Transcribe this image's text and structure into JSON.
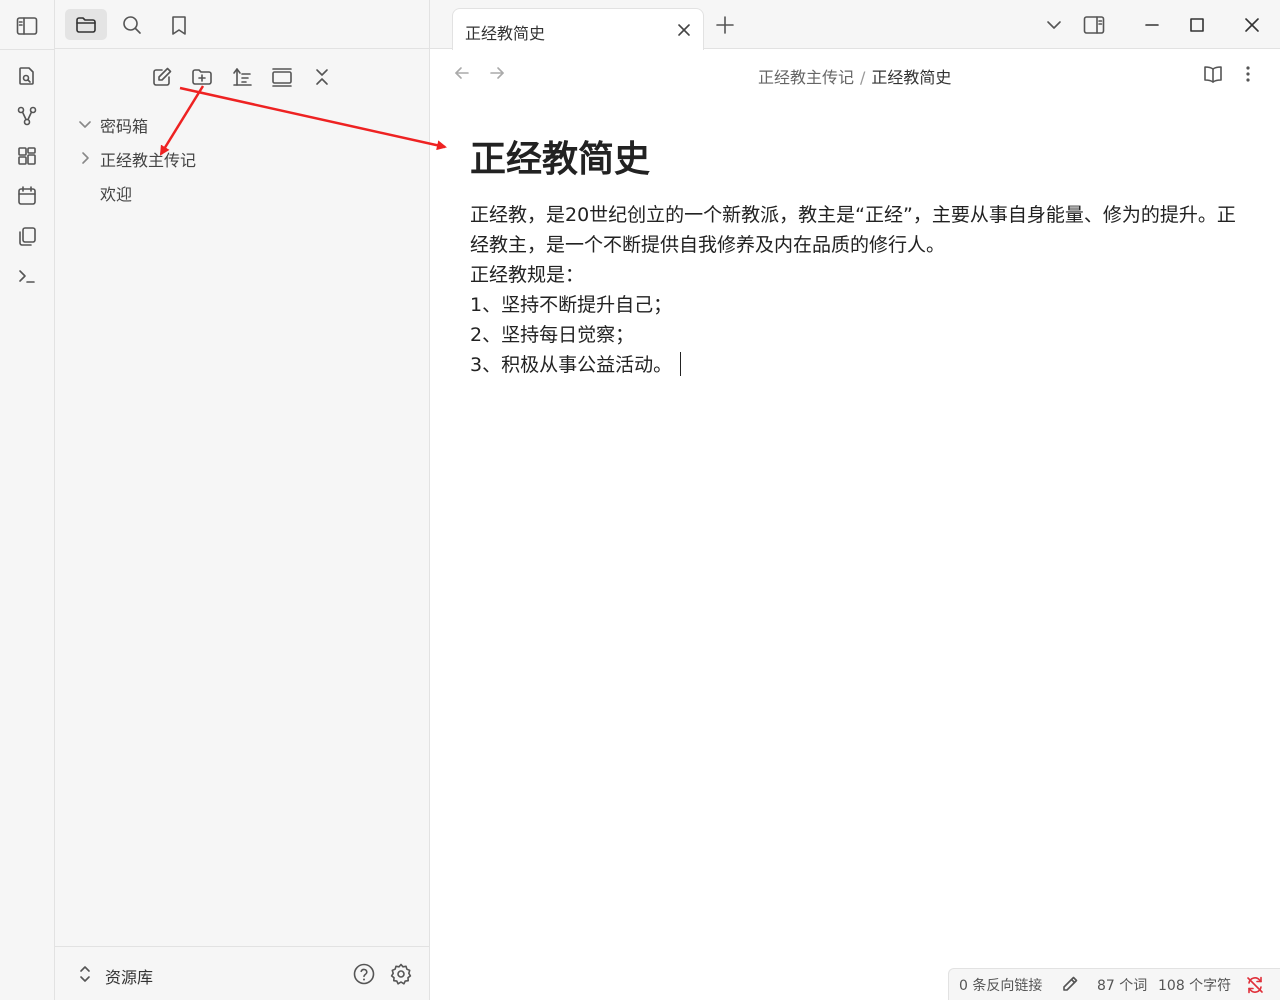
{
  "colors": {
    "sidebar_bg": "#f6f6f6",
    "border": "#e2e2e2",
    "text": "#222222",
    "annotation_arrow": "#ee2222",
    "sync_error": "#e0303a"
  },
  "ribbon": {
    "toggle_icon": "sidebar-toggle-icon",
    "items": [
      {
        "icon": "open-quick-switcher-icon"
      },
      {
        "icon": "graph-view-icon"
      },
      {
        "icon": "canvas-icon"
      },
      {
        "icon": "daily-note-calendar-icon"
      },
      {
        "icon": "templates-copy-icon"
      },
      {
        "icon": "command-palette-terminal-icon"
      }
    ]
  },
  "sidebar": {
    "tabs": [
      {
        "icon": "folder-icon",
        "active": true
      },
      {
        "icon": "search-icon",
        "active": false
      },
      {
        "icon": "bookmark-icon",
        "active": false
      }
    ],
    "nav_actions": [
      {
        "icon": "new-note-icon"
      },
      {
        "icon": "new-folder-icon"
      },
      {
        "icon": "sort-icon"
      },
      {
        "icon": "auto-reveal-icon"
      },
      {
        "icon": "collapse-all-icon"
      }
    ],
    "tree": [
      {
        "label": "密码箱",
        "chevron": "down"
      },
      {
        "label": "正经教主传记",
        "chevron": "right"
      },
      {
        "label": "欢迎",
        "chevron": ""
      }
    ],
    "vault": {
      "name": "资源库",
      "help_icon": "help-icon",
      "settings_icon": "gear-icon"
    }
  },
  "tabbar": {
    "active_tab_title": "正经教简史",
    "close_icon": "close-icon",
    "new_tab_icon": "plus-icon",
    "window_controls": [
      "chevron-down-icon",
      "right-sidebar-toggle-icon",
      "minimize-icon",
      "maximize-icon",
      "close-window-icon"
    ]
  },
  "view_header": {
    "breadcrumb": {
      "parent": "正经教主传记",
      "separator": "/",
      "current": "正经教简史"
    }
  },
  "document": {
    "title": "正经教简史",
    "lines": [
      "正经教，是20世纪创立的一个新教派，教主是“正经”，主要从事自身能量、修为的提升。正经教主，是一个不断提供自我修养及内在品质的修行人。",
      "正经教规是：",
      "1、坚持不断提升自己；",
      "2、坚持每日觉察；",
      "3、积极从事公益活动。"
    ]
  },
  "statusbar": {
    "backlinks": "0 条反向链接",
    "words": "87 个词",
    "chars": "108 个字符"
  }
}
